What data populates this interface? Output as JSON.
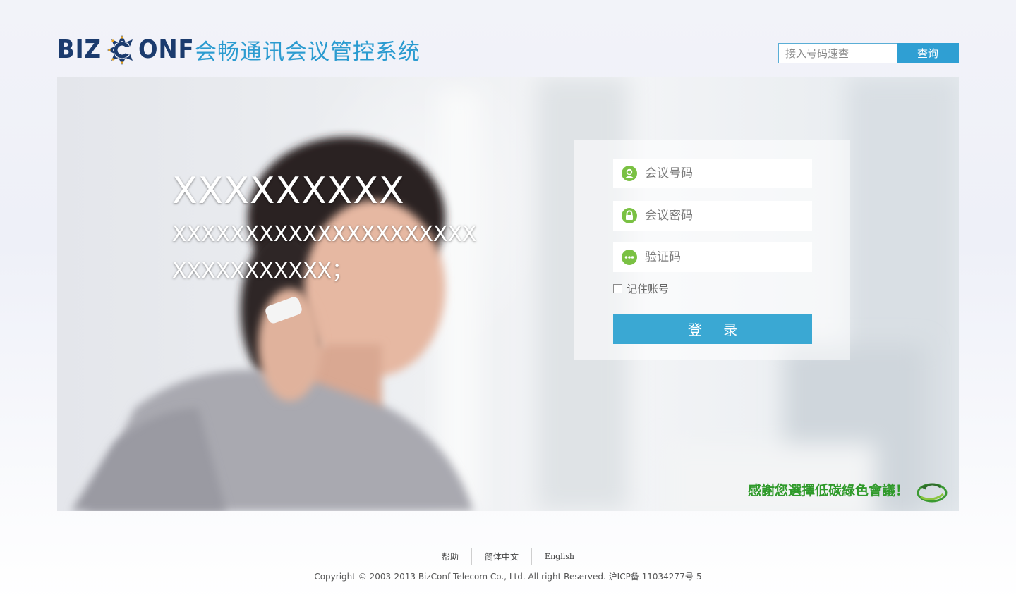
{
  "header": {
    "logo_left": "BIZ",
    "logo_right": "ONF",
    "system_title": "会畅通讯会议管控系统",
    "search": {
      "placeholder": "接入号码速查",
      "button_label": "查询"
    }
  },
  "hero": {
    "main_text": "XXXXXXXXX",
    "sub_text": "XXXXXXXXXXXXXXXXXXXXXXXXXXXXXXXX；",
    "green_slogan": "感謝您選擇低碳綠色會議！"
  },
  "login": {
    "meeting_number_placeholder": "会议号码",
    "meeting_password_placeholder": "会议密码",
    "captcha_placeholder": "验证码",
    "remember_label": "记住账号",
    "remember_checked": false,
    "login_button": "登 录"
  },
  "footer": {
    "links": [
      "帮助",
      "简体中文",
      "English"
    ],
    "copyright": "Copyright © 2003-2013 BizConf Telecom Co., Ltd. All right Reserved. 沪ICP备 11034277号-5"
  },
  "colors": {
    "brand_navy": "#1b3b6e",
    "title_blue": "#2b9bd0",
    "button_blue": "#3aa8d3",
    "icon_green": "#7ac143",
    "slogan_green": "#2f9a2a"
  },
  "icons": {
    "meeting_number": "user-icon",
    "meeting_password": "lock-icon",
    "captcha": "dots-icon",
    "green": "recycle-leaf-icon"
  }
}
